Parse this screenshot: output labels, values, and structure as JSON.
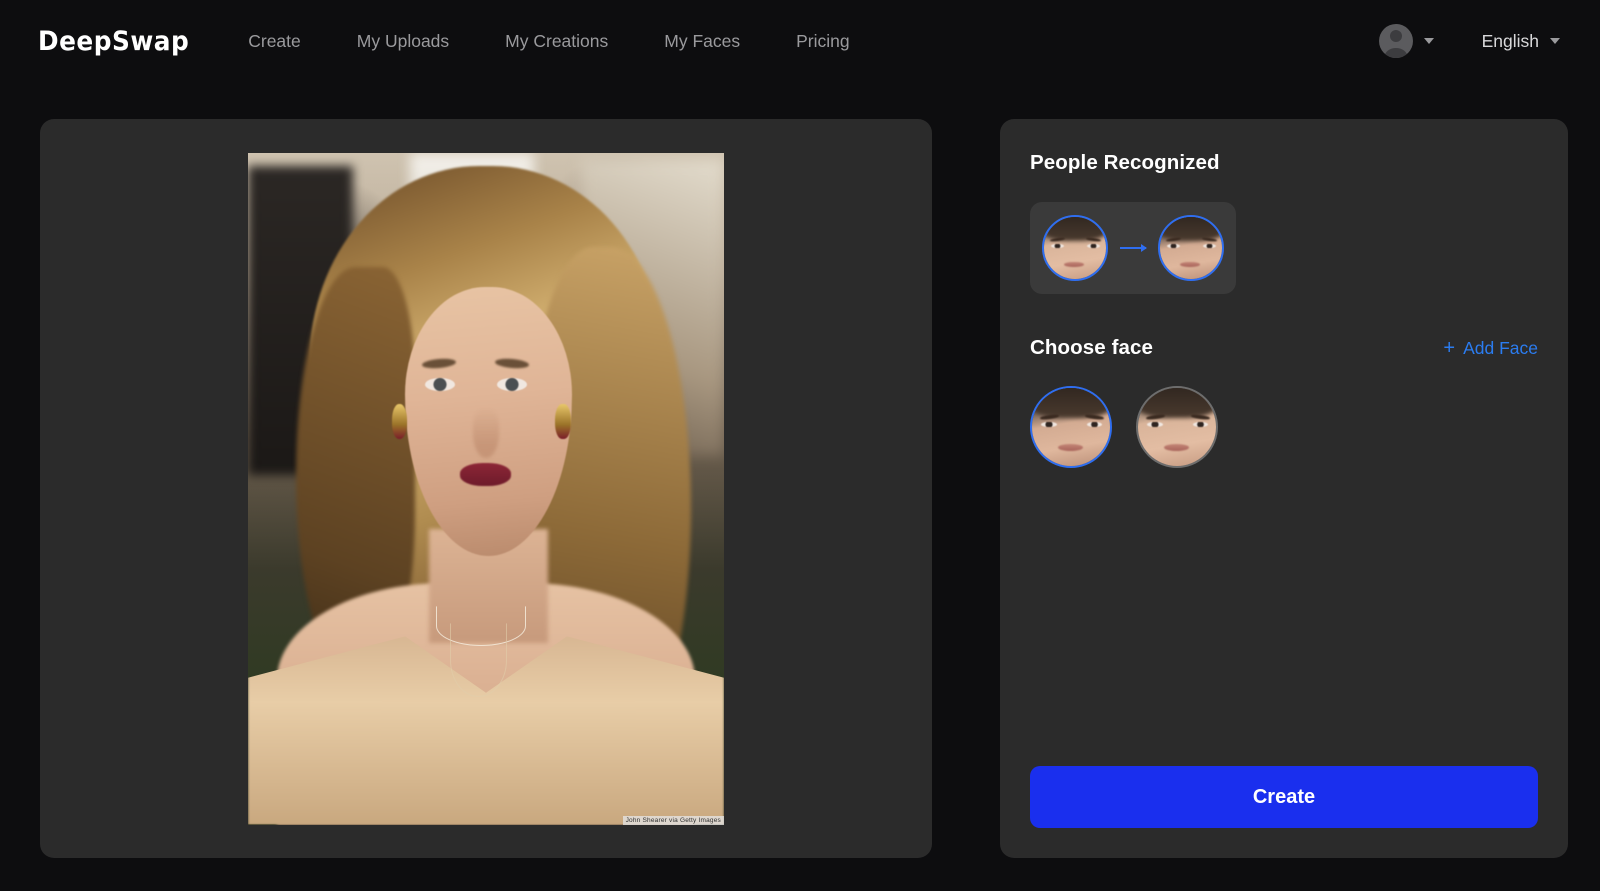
{
  "header": {
    "logo": "DeepSwap",
    "nav": [
      {
        "label": "Create"
      },
      {
        "label": "My Uploads"
      },
      {
        "label": "My Creations"
      },
      {
        "label": "My Faces"
      },
      {
        "label": "Pricing"
      }
    ],
    "account": {
      "avatar_icon": "user-avatar-icon",
      "chevron_icon": "chevron-down-icon"
    },
    "language": {
      "label": "English",
      "chevron_icon": "chevron-down-icon"
    }
  },
  "preview": {
    "watermark": "John Shearer via Getty Images",
    "alt": "portrait-photo"
  },
  "sidebar": {
    "people_recognized": {
      "title": "People Recognized",
      "pairs": [
        {
          "source_label": "source-face",
          "target_label": "target-face",
          "arrow_icon": "arrow-right-icon",
          "selected": true
        }
      ]
    },
    "choose_face": {
      "title": "Choose face",
      "add_face_label": "Add Face",
      "add_face_icon": "plus-icon",
      "faces": [
        {
          "label": "face-option-1",
          "selected": true
        },
        {
          "label": "face-option-2",
          "selected": false
        }
      ]
    },
    "create_button": "Create"
  },
  "colors": {
    "page_bg": "#0d0d0f",
    "panel_bg": "#2b2b2b",
    "chip_bg": "#3a3a3a",
    "accent_blue": "#2f6ef0",
    "link_blue": "#2b7cf0",
    "create_blue": "#1a2fee",
    "nav_text": "#9a9a9d",
    "title_text": "#ffffff"
  }
}
